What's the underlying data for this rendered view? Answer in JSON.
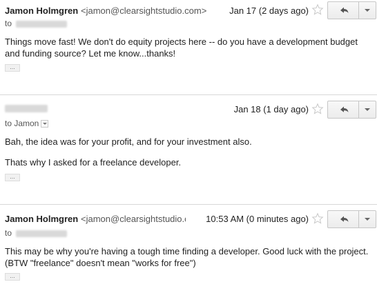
{
  "messages": [
    {
      "sender": "Jamon Holmgren",
      "email": "<jamon@clearsightstudio.com>",
      "date": "Jan 17 (2 days ago)",
      "to_prefix": "to",
      "body": [
        "Things move fast! We don't do equity projects here -- do you have a development budget and funding source? Let me know...thanks!"
      ],
      "ellipsis": "..."
    },
    {
      "sender": "",
      "email": "",
      "date": "Jan 18 (1 day ago)",
      "to_prefix": "to Jamon",
      "body": [
        "Bah, the idea was for your profit, and for your investment also.",
        "Thats why I asked for a freelance developer."
      ],
      "ellipsis": "..."
    },
    {
      "sender": "Jamon Holmgren",
      "email": "<jamon@clearsightstudio.c",
      "date": "10:53 AM (0 minutes ago)",
      "to_prefix": "to",
      "body": [
        "This may be why you're having a tough time finding a developer. Good luck with the project. (BTW \"freelance\" doesn't mean \"works for free\")"
      ],
      "ellipsis": "..."
    }
  ],
  "icons": {
    "star": "star-outline-icon",
    "reply": "reply-arrow-icon",
    "more": "chevron-down-icon"
  },
  "colors": {
    "star_outline": "#c8c8c8",
    "button_border": "#c6c6c6",
    "reply_arrow": "#555555"
  }
}
